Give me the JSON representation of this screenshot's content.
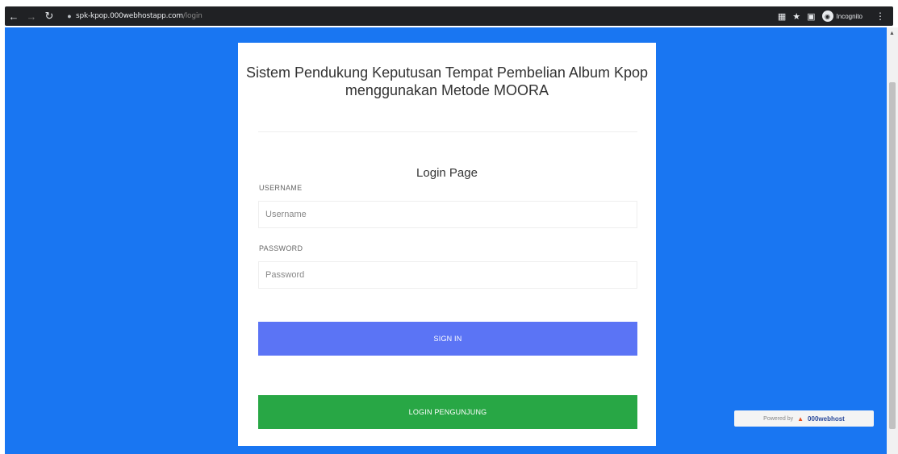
{
  "browser": {
    "url_host": "spk-kpop.000webhostapp.com",
    "url_path": "/login",
    "incognito_label": "Incognito",
    "icons": {
      "back": "back-arrow-icon",
      "forward": "forward-arrow-icon",
      "reload": "reload-icon",
      "lock": "lock-icon",
      "translate": "translate-icon",
      "bookmark": "star-icon",
      "tab": "tab-icon",
      "incognito": "incognito-icon",
      "menu": "kebab-menu-icon"
    }
  },
  "card": {
    "title": "Sistem Pendukung Keputusan Tempat Pembelian Album Kpop menggunakan Metode MOORA",
    "login_heading": "Login Page",
    "username_label": "USERNAME",
    "username_placeholder": "Username",
    "password_label": "PASSWORD",
    "password_placeholder": "Password",
    "signin_label": "SIGN IN",
    "visitor_label": "LOGIN PENGUNJUNG"
  },
  "footer": {
    "powered_by": "Powered by",
    "brand": "000webhost"
  },
  "colors": {
    "background": "#1976f2",
    "signin_button": "#5b74f5",
    "visitor_button": "#28a745",
    "card": "#ffffff"
  }
}
